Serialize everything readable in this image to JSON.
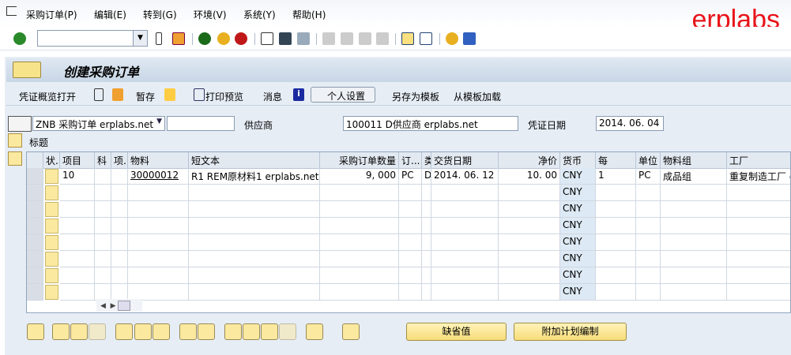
{
  "menu": [
    "采购订单(P)",
    "编辑(E)",
    "转到(G)",
    "环境(V)",
    "系统(Y)",
    "帮助(H)"
  ],
  "logo": "erplabs",
  "title": "创建采购订单",
  "appbar": {
    "overview": "凭证概览打开",
    "hold": "暂存",
    "print_preview": "打印预览",
    "messages": "消息",
    "personal": "个人设置",
    "save_template": "另存为模板",
    "load_template": "从模板加载"
  },
  "header": {
    "doc_type": "ZNB 采购订单 erplabs.net",
    "vendor_label": "供应商",
    "vendor": "100011 D供应商 erplabs.net",
    "date_label": "凭证日期",
    "date": "2014. 06. 04",
    "header_label": "标题"
  },
  "columns": [
    "",
    "状.",
    "项目",
    "科",
    "项.",
    "物料",
    "短文本",
    "采购订单数量",
    "订...",
    "类",
    "交货日期",
    "净价",
    "货币",
    "每",
    "单位",
    "物料组",
    "工厂"
  ],
  "items": [
    {
      "item": "10",
      "material": "30000012",
      "text": "R1 REM原材料1 erplabs.net",
      "qty": "9, 000",
      "uom": "PC",
      "cat": "D",
      "date": "2014. 06. 12",
      "price": "10. 00",
      "curr": "CNY",
      "per": "1",
      "unit": "PC",
      "group": "成品组",
      "plant": "重复制造工厂 e"
    }
  ],
  "empty_currency": "CNY",
  "buttons": {
    "defaults": "缺省值",
    "schedule": "附加计划编制"
  }
}
